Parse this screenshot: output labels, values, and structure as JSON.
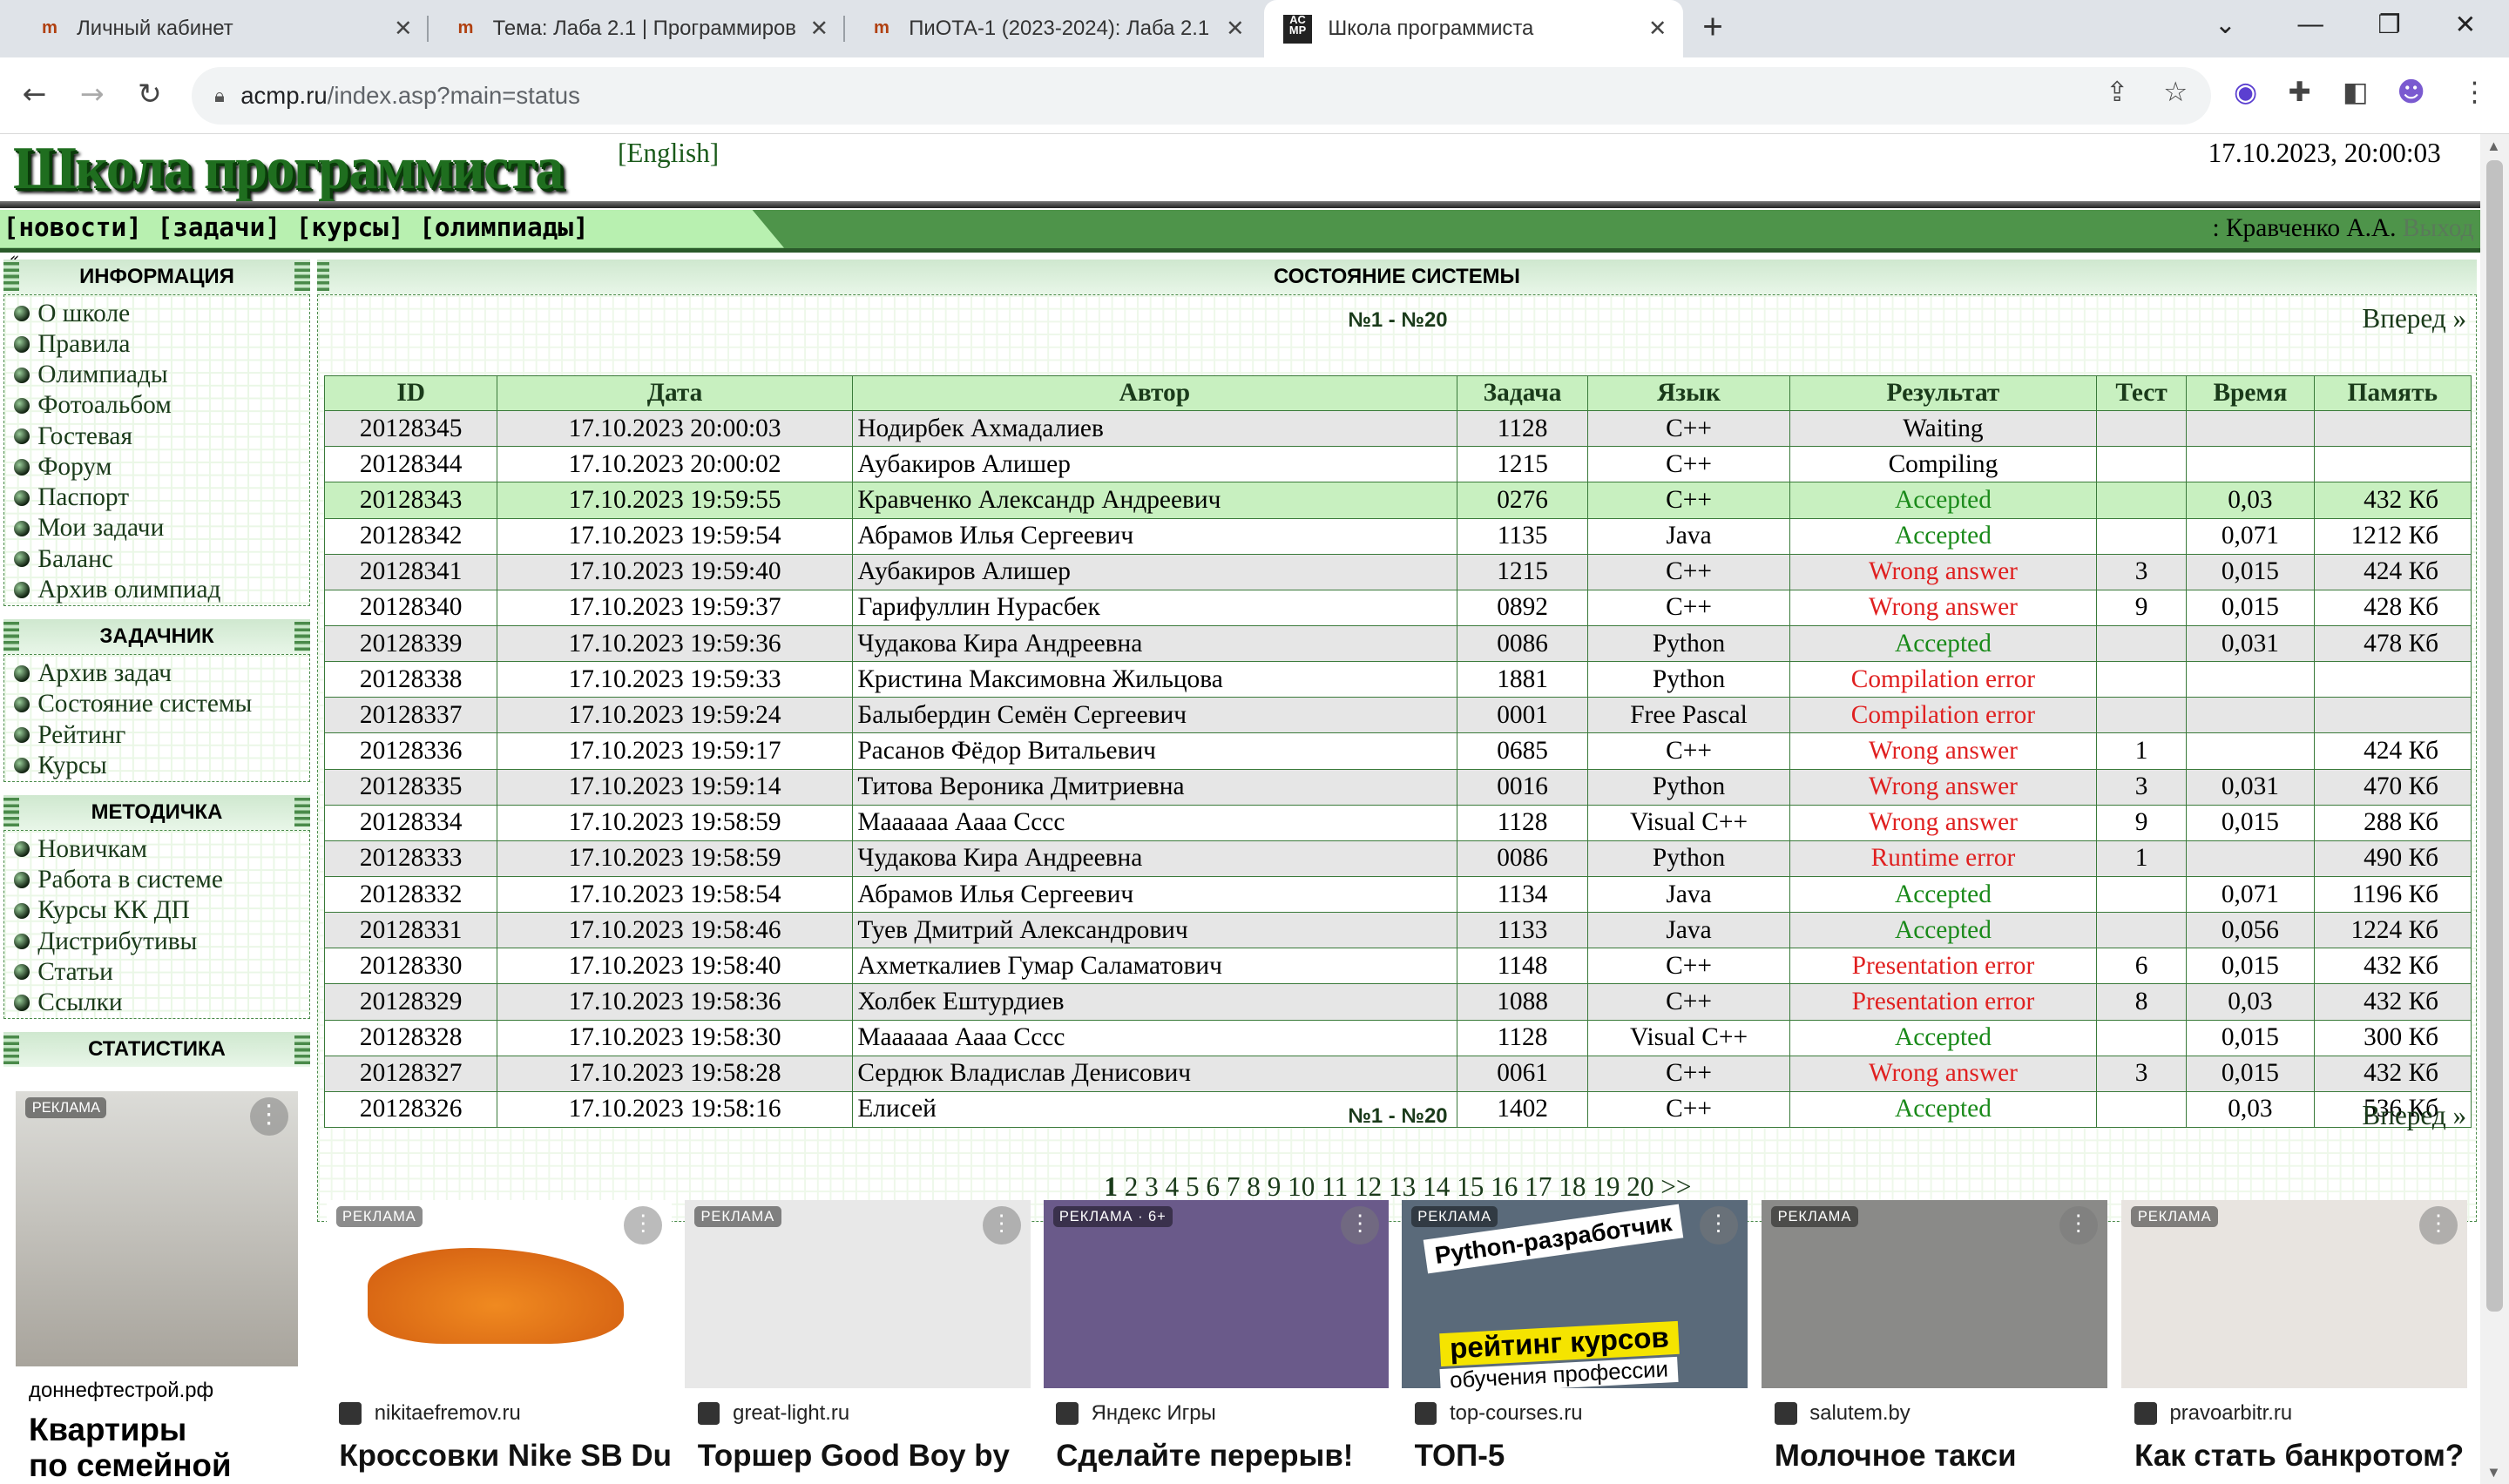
{
  "browser": {
    "tabs": [
      {
        "title": "Личный кабинет",
        "icon": "moodle-icon"
      },
      {
        "title": "Тема: Лаба 2.1 | Программиров",
        "icon": "moodle-icon"
      },
      {
        "title": "ПиОТА-1 (2023-2024): Лаба 2.1",
        "icon": "moodle-icon"
      },
      {
        "title": "Школа программиста",
        "icon": "acmp-icon",
        "favtext": "AC MP"
      }
    ],
    "url_domain": "acmp.ru",
    "url_path": "/index.asp?main=status"
  },
  "header": {
    "logo": "Школа программиста",
    "lang_link": "[English]",
    "datetime": "17.10.2023, 20:00:03"
  },
  "menu": {
    "links": [
      "[новости]",
      "[задачи]",
      "[курсы]",
      "[олимпиады]"
    ],
    "user": ": Кравченко А.А.",
    "logout": "Выход",
    "marker": "«"
  },
  "sidebar": {
    "sections": [
      {
        "title": "ИНФОРМАЦИЯ",
        "items": [
          "О школе",
          "Правила",
          "Олимпиады",
          "Фотоальбом",
          "Гостевая",
          "Форум",
          "Паспорт",
          "Мои задачи",
          "Баланс",
          "Архив олимпиад"
        ]
      },
      {
        "title": "ЗАДАЧНИК",
        "items": [
          "Архив задач",
          "Состояние системы",
          "Рейтинг",
          "Курсы"
        ]
      },
      {
        "title": "МЕТОДИЧКА",
        "items": [
          "Новичкам",
          "Работа в системе",
          "Курсы КК ДП",
          "Дистрибутивы",
          "Статьи",
          "Ссылки"
        ]
      },
      {
        "title": "СТАТИСТИКА",
        "items": []
      }
    ]
  },
  "status": {
    "title": "СОСТОЯНИЕ СИСТЕМЫ",
    "range": "№1 - №20",
    "forward": "Вперед »",
    "columns": [
      "ID",
      "Дата",
      "Автор",
      "Задача",
      "Язык",
      "Результат",
      "Тест",
      "Время",
      "Память"
    ],
    "rows": [
      {
        "id": "20128345",
        "date": "17.10.2023 20:00:03",
        "author": "Нодирбек Ахмадалиев",
        "task": "1128",
        "lang": "C++",
        "result": "Waiting",
        "kind": "neu",
        "test": "",
        "time": "",
        "mem": ""
      },
      {
        "id": "20128344",
        "date": "17.10.2023 20:00:02",
        "author": "Аубакиров Алишер",
        "task": "1215",
        "lang": "C++",
        "result": "Compiling",
        "kind": "neu",
        "test": "",
        "time": "",
        "mem": ""
      },
      {
        "id": "20128343",
        "date": "17.10.2023 19:59:55",
        "author": "Кравченко Александр Андреевич",
        "task": "0276",
        "lang": "C++",
        "result": "Accepted",
        "kind": "ok",
        "test": "",
        "time": "0,03",
        "mem": "432 Кб",
        "me": true
      },
      {
        "id": "20128342",
        "date": "17.10.2023 19:59:54",
        "author": "Абрамов Илья Сергеевич",
        "task": "1135",
        "lang": "Java",
        "result": "Accepted",
        "kind": "ok",
        "test": "",
        "time": "0,071",
        "mem": "1212 Кб"
      },
      {
        "id": "20128341",
        "date": "17.10.2023 19:59:40",
        "author": "Аубакиров Алишер",
        "task": "1215",
        "lang": "C++",
        "result": "Wrong answer",
        "kind": "err",
        "test": "3",
        "time": "0,015",
        "mem": "424 Кб"
      },
      {
        "id": "20128340",
        "date": "17.10.2023 19:59:37",
        "author": "Гарифуллин Нурасбек",
        "task": "0892",
        "lang": "C++",
        "result": "Wrong answer",
        "kind": "err",
        "test": "9",
        "time": "0,015",
        "mem": "428 Кб"
      },
      {
        "id": "20128339",
        "date": "17.10.2023 19:59:36",
        "author": "Чудакова Кира Андреевна",
        "task": "0086",
        "lang": "Python",
        "result": "Accepted",
        "kind": "ok",
        "test": "",
        "time": "0,031",
        "mem": "478 Кб"
      },
      {
        "id": "20128338",
        "date": "17.10.2023 19:59:33",
        "author": "Кристина Максимовна Жильцова",
        "task": "1881",
        "lang": "Python",
        "result": "Compilation error",
        "kind": "err",
        "test": "",
        "time": "",
        "mem": ""
      },
      {
        "id": "20128337",
        "date": "17.10.2023 19:59:24",
        "author": "Балыбердин Семён Сергеевич",
        "task": "0001",
        "lang": "Free Pascal",
        "result": "Compilation error",
        "kind": "err",
        "test": "",
        "time": "",
        "mem": ""
      },
      {
        "id": "20128336",
        "date": "17.10.2023 19:59:17",
        "author": "Расанов Фёдор Витальевич",
        "task": "0685",
        "lang": "C++",
        "result": "Wrong answer",
        "kind": "err",
        "test": "1",
        "time": "",
        "mem": "424 Кб"
      },
      {
        "id": "20128335",
        "date": "17.10.2023 19:59:14",
        "author": "Титова Вероника Дмитриевна",
        "task": "0016",
        "lang": "Python",
        "result": "Wrong answer",
        "kind": "err",
        "test": "3",
        "time": "0,031",
        "mem": "470 Кб"
      },
      {
        "id": "20128334",
        "date": "17.10.2023 19:58:59",
        "author": "Маааааа Аааа Сссс",
        "task": "1128",
        "lang": "Visual C++",
        "result": "Wrong answer",
        "kind": "err",
        "test": "9",
        "time": "0,015",
        "mem": "288 Кб"
      },
      {
        "id": "20128333",
        "date": "17.10.2023 19:58:59",
        "author": "Чудакова Кира Андреевна",
        "task": "0086",
        "lang": "Python",
        "result": "Runtime error",
        "kind": "err",
        "test": "1",
        "time": "",
        "mem": "490 Кб"
      },
      {
        "id": "20128332",
        "date": "17.10.2023 19:58:54",
        "author": "Абрамов Илья Сергеевич",
        "task": "1134",
        "lang": "Java",
        "result": "Accepted",
        "kind": "ok",
        "test": "",
        "time": "0,071",
        "mem": "1196 Кб"
      },
      {
        "id": "20128331",
        "date": "17.10.2023 19:58:46",
        "author": "Туев Дмитрий Александрович",
        "task": "1133",
        "lang": "Java",
        "result": "Accepted",
        "kind": "ok",
        "test": "",
        "time": "0,056",
        "mem": "1224 Кб"
      },
      {
        "id": "20128330",
        "date": "17.10.2023 19:58:40",
        "author": "Ахметкалиев Гумар Саламатович",
        "task": "1148",
        "lang": "C++",
        "result": "Presentation error",
        "kind": "err",
        "test": "6",
        "time": "0,015",
        "mem": "432 Кб"
      },
      {
        "id": "20128329",
        "date": "17.10.2023 19:58:36",
        "author": "Холбек Ештурдиев",
        "task": "1088",
        "lang": "C++",
        "result": "Presentation error",
        "kind": "err",
        "test": "8",
        "time": "0,03",
        "mem": "432 Кб"
      },
      {
        "id": "20128328",
        "date": "17.10.2023 19:58:30",
        "author": "Маааааа Аааа Сссс",
        "task": "1128",
        "lang": "Visual C++",
        "result": "Accepted",
        "kind": "ok",
        "test": "",
        "time": "0,015",
        "mem": "300 Кб"
      },
      {
        "id": "20128327",
        "date": "17.10.2023 19:58:28",
        "author": "Сердюк Владислав Денисович",
        "task": "0061",
        "lang": "C++",
        "result": "Wrong answer",
        "kind": "err",
        "test": "3",
        "time": "0,015",
        "mem": "432 Кб"
      },
      {
        "id": "20128326",
        "date": "17.10.2023 19:58:16",
        "author": "Елисей",
        "task": "1402",
        "lang": "C++",
        "result": "Accepted",
        "kind": "ok",
        "test": "",
        "time": "0,03",
        "mem": "536 Кб"
      }
    ],
    "pages": [
      "1",
      "2",
      "3",
      "4",
      "5",
      "6",
      "7",
      "8",
      "9",
      "10",
      "11",
      "12",
      "13",
      "14",
      "15",
      "16",
      "17",
      "18",
      "19",
      "20"
    ],
    "current_page": "1",
    "next_pages": ">>"
  },
  "ads": [
    {
      "tag": "РЕКЛАМА",
      "source": "доннефтестрой.рф",
      "headline": "Квартиры",
      "headline2": "по семейной",
      "color": "#b8c0c8"
    },
    {
      "tag": "РЕКЛАМА",
      "source": "nikitaefremov.ru",
      "headline": "Кроссовки Nike SB Dunk",
      "color": "#ffffff"
    },
    {
      "tag": "РЕКЛАМА",
      "source": "great-light.ru",
      "headline": "Торшер Good Boy by",
      "color": "#e8e8e8"
    },
    {
      "tag": "РЕКЛАМА · 6+",
      "source": "Яндекс Игры",
      "headline": "Сделайте перерыв!",
      "color": "#6a5a8a"
    },
    {
      "tag": "РЕКЛАМА",
      "source": "top-courses.ru",
      "headline": "ТОП-5",
      "banner1": "Python-разработчик",
      "banner2": "рейтинг курсов",
      "banner3": "обучения профессии",
      "color": "#5a6a7a"
    },
    {
      "tag": "РЕКЛАМА",
      "source": "salutem.by",
      "headline": "Молочное такси",
      "color": "#8a8a88"
    },
    {
      "tag": "РЕКЛАМА",
      "source": "pravoarbitr.ru",
      "headline": "Как стать банкротом?",
      "color": "#e8e4e0"
    }
  ]
}
